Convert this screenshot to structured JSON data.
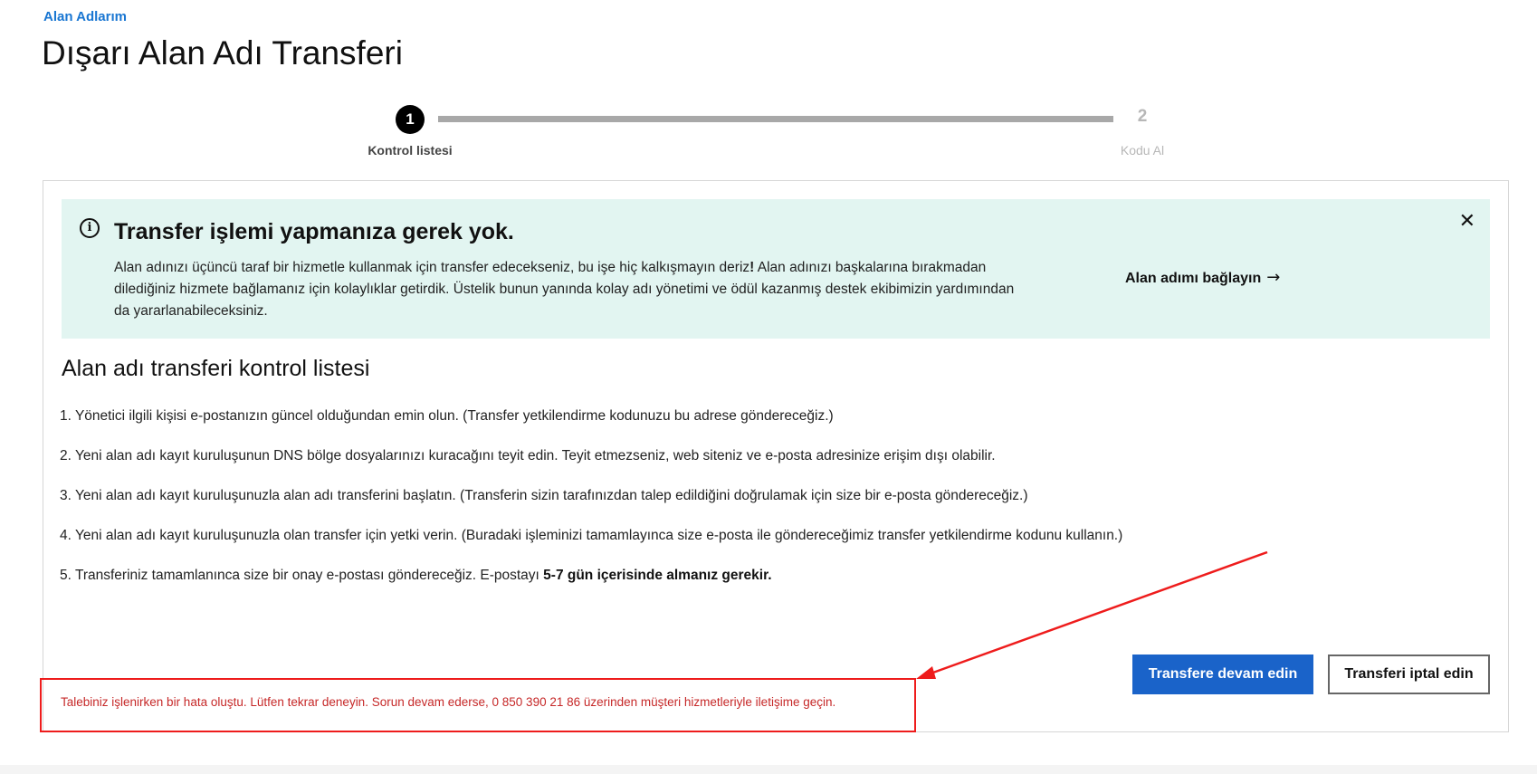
{
  "breadcrumb": {
    "label": "Alan Adlarım"
  },
  "page": {
    "title": "Dışarı Alan Adı Transferi"
  },
  "stepper": {
    "steps": [
      {
        "number": "1",
        "label": "Kontrol listesi",
        "state": "active"
      },
      {
        "number": "2",
        "label": "Kodu Al",
        "state": "inactive"
      }
    ]
  },
  "banner": {
    "title": "Transfer işlemi yapmanıza gerek yok.",
    "text_part1": "Alan adınızı üçüncü taraf bir hizmetle kullanmak için transfer edecekseniz, bu işe hiç kalkışmayın deriz",
    "text_bold": "!",
    "text_part2": " Alan adınızı başkalarına bırakmadan dilediğiniz hizmete bağlamanız için kolaylıklar getirdik. Üstelik bunun yanında kolay adı yönetimi ve ödül kazanmış destek ekibimizin yardımından da yararlanabileceksiniz.",
    "link_label": "Alan adımı bağlayın",
    "link_arrow": "→",
    "close_glyph": "✕",
    "info_glyph": "i",
    "background_color": "#e2f5f1"
  },
  "checklist": {
    "title": "Alan adı transferi kontrol listesi",
    "items": [
      "1. Yönetici ilgili kişisi e-postanızın güncel olduğundan emin olun. (Transfer yetkilendirme kodunuzu bu adrese göndereceğiz.)",
      "2. Yeni alan adı kayıt kuruluşunun DNS bölge dosyalarınızı kuracağını teyit edin. Teyit etmezseniz, web siteniz ve e-posta adresinize erişim dışı olabilir.",
      "3. Yeni alan adı kayıt kuruluşunuzla alan adı transferini başlatın. (Transferin sizin tarafınızdan talep edildiğini doğrulamak için size bir e-posta göndereceğiz.)",
      "4. Yeni alan adı kayıt kuruluşunuzla olan transfer için yetki verin. (Buradaki işleminizi tamamlayınca size e-posta ile göndereceğimiz transfer yetkilendirme kodunu kullanın.)"
    ],
    "item5_text": "5. Transferiniz tamamlanınca size bir onay e-postası göndereceğiz. E-postayı ",
    "item5_bold": "5-7 gün içerisinde almanız gerekir."
  },
  "actions": {
    "continue_label": "Transfere devam edin",
    "cancel_label": "Transferi iptal edin",
    "primary_color": "#1a63c9"
  },
  "error": {
    "message": "Talebiniz işlenirken bir hata oluştu. Lütfen tekrar deneyin. Sorun devam ederse, 0 850 390 21 86 üzerinden müşteri hizmetleriyle iletişime geçin.",
    "color": "#c62828"
  },
  "annotation": {
    "color": "#ee1c1c"
  }
}
